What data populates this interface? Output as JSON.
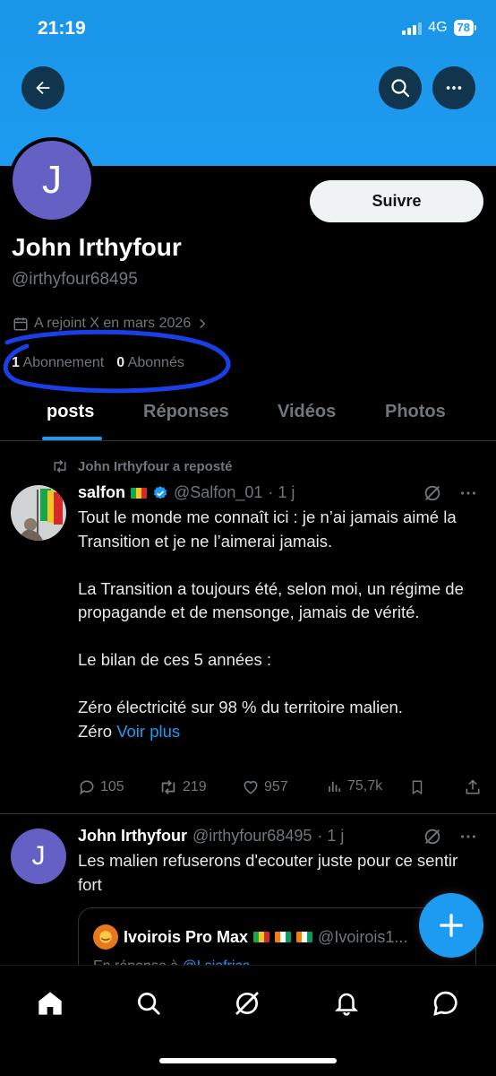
{
  "status_bar": {
    "time": "21:19",
    "network": "4G",
    "battery": "78"
  },
  "header": {
    "back_icon": "arrow-left-icon",
    "search_icon": "search-icon",
    "more_icon": "more-horizontal-icon"
  },
  "profile": {
    "avatar_letter": "J",
    "follow_label": "Suivre",
    "name": "John Irthyfour",
    "handle": "@irthyfour68495",
    "joined": "A rejoint X en mars 2026",
    "following_count": "1",
    "following_label": "Abonnement",
    "followers_count": "0",
    "followers_label": "Abonnés"
  },
  "tabs": [
    {
      "label": "posts",
      "active": true
    },
    {
      "label": "Réponses",
      "active": false
    },
    {
      "label": "Vidéos",
      "active": false
    },
    {
      "label": "Photos",
      "active": false
    }
  ],
  "posts": [
    {
      "repost_label": "John Irthyfour a reposté",
      "author": "salfon",
      "handle": "@Salfon_01",
      "time": "· 1 j",
      "lines": [
        "Tout le monde me connaît ici : je n’ai jamais aimé la Transition et je ne l’aimerai jamais.",
        "La Transition a toujours été, selon moi, un régime de propagande et de mensonge, jamais de vérité.",
        "Le bilan de ces 5 années :",
        "Zéro électricité sur 98 % du territoire malien."
      ],
      "last_line_prefix": "Zéro",
      "see_more": "Voir plus",
      "replies": "105",
      "reposts": "219",
      "likes": "957",
      "views": "75,7k"
    },
    {
      "author": "John Irthyfour",
      "handle": "@irthyfour68495",
      "time": "· 1 j",
      "avatar_letter": "J",
      "text": "Les malien refuserons d'ecouter juste pour ce sentir fort",
      "quote": {
        "author": "Ivoirois Pro Max",
        "handle": "@Ivoirois1...",
        "reply_prefix": "En réponse à",
        "reply_to": "@Lsiafrica"
      }
    }
  ],
  "colors": {
    "accent": "#1d9bf0",
    "background": "#000000",
    "muted": "#71767b",
    "annotation": "#1a3fe6"
  }
}
